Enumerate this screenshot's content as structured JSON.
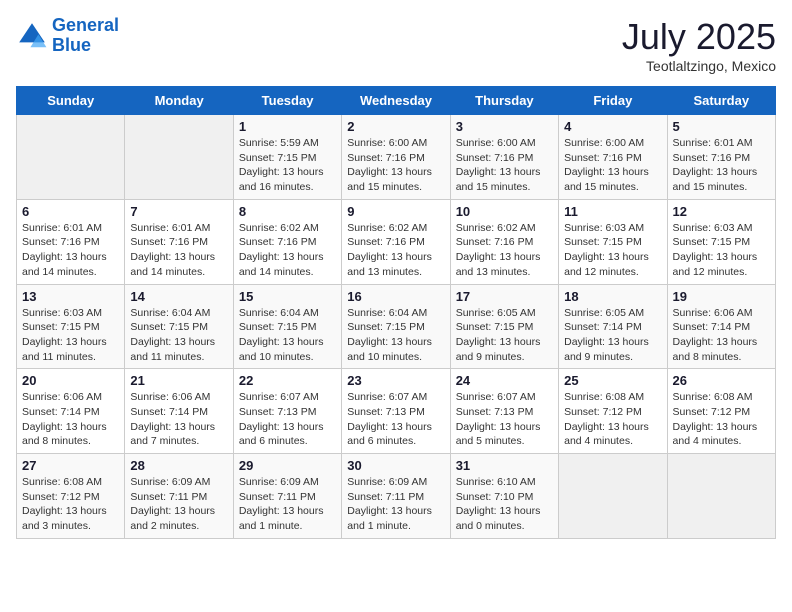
{
  "header": {
    "logo_line1": "General",
    "logo_line2": "Blue",
    "month": "July 2025",
    "location": "Teotlaltzingo, Mexico"
  },
  "weekdays": [
    "Sunday",
    "Monday",
    "Tuesday",
    "Wednesday",
    "Thursday",
    "Friday",
    "Saturday"
  ],
  "weeks": [
    [
      {
        "day": "",
        "info": ""
      },
      {
        "day": "",
        "info": ""
      },
      {
        "day": "1",
        "info": "Sunrise: 5:59 AM\nSunset: 7:15 PM\nDaylight: 13 hours\nand 16 minutes."
      },
      {
        "day": "2",
        "info": "Sunrise: 6:00 AM\nSunset: 7:16 PM\nDaylight: 13 hours\nand 15 minutes."
      },
      {
        "day": "3",
        "info": "Sunrise: 6:00 AM\nSunset: 7:16 PM\nDaylight: 13 hours\nand 15 minutes."
      },
      {
        "day": "4",
        "info": "Sunrise: 6:00 AM\nSunset: 7:16 PM\nDaylight: 13 hours\nand 15 minutes."
      },
      {
        "day": "5",
        "info": "Sunrise: 6:01 AM\nSunset: 7:16 PM\nDaylight: 13 hours\nand 15 minutes."
      }
    ],
    [
      {
        "day": "6",
        "info": "Sunrise: 6:01 AM\nSunset: 7:16 PM\nDaylight: 13 hours\nand 14 minutes."
      },
      {
        "day": "7",
        "info": "Sunrise: 6:01 AM\nSunset: 7:16 PM\nDaylight: 13 hours\nand 14 minutes."
      },
      {
        "day": "8",
        "info": "Sunrise: 6:02 AM\nSunset: 7:16 PM\nDaylight: 13 hours\nand 14 minutes."
      },
      {
        "day": "9",
        "info": "Sunrise: 6:02 AM\nSunset: 7:16 PM\nDaylight: 13 hours\nand 13 minutes."
      },
      {
        "day": "10",
        "info": "Sunrise: 6:02 AM\nSunset: 7:16 PM\nDaylight: 13 hours\nand 13 minutes."
      },
      {
        "day": "11",
        "info": "Sunrise: 6:03 AM\nSunset: 7:15 PM\nDaylight: 13 hours\nand 12 minutes."
      },
      {
        "day": "12",
        "info": "Sunrise: 6:03 AM\nSunset: 7:15 PM\nDaylight: 13 hours\nand 12 minutes."
      }
    ],
    [
      {
        "day": "13",
        "info": "Sunrise: 6:03 AM\nSunset: 7:15 PM\nDaylight: 13 hours\nand 11 minutes."
      },
      {
        "day": "14",
        "info": "Sunrise: 6:04 AM\nSunset: 7:15 PM\nDaylight: 13 hours\nand 11 minutes."
      },
      {
        "day": "15",
        "info": "Sunrise: 6:04 AM\nSunset: 7:15 PM\nDaylight: 13 hours\nand 10 minutes."
      },
      {
        "day": "16",
        "info": "Sunrise: 6:04 AM\nSunset: 7:15 PM\nDaylight: 13 hours\nand 10 minutes."
      },
      {
        "day": "17",
        "info": "Sunrise: 6:05 AM\nSunset: 7:15 PM\nDaylight: 13 hours\nand 9 minutes."
      },
      {
        "day": "18",
        "info": "Sunrise: 6:05 AM\nSunset: 7:14 PM\nDaylight: 13 hours\nand 9 minutes."
      },
      {
        "day": "19",
        "info": "Sunrise: 6:06 AM\nSunset: 7:14 PM\nDaylight: 13 hours\nand 8 minutes."
      }
    ],
    [
      {
        "day": "20",
        "info": "Sunrise: 6:06 AM\nSunset: 7:14 PM\nDaylight: 13 hours\nand 8 minutes."
      },
      {
        "day": "21",
        "info": "Sunrise: 6:06 AM\nSunset: 7:14 PM\nDaylight: 13 hours\nand 7 minutes."
      },
      {
        "day": "22",
        "info": "Sunrise: 6:07 AM\nSunset: 7:13 PM\nDaylight: 13 hours\nand 6 minutes."
      },
      {
        "day": "23",
        "info": "Sunrise: 6:07 AM\nSunset: 7:13 PM\nDaylight: 13 hours\nand 6 minutes."
      },
      {
        "day": "24",
        "info": "Sunrise: 6:07 AM\nSunset: 7:13 PM\nDaylight: 13 hours\nand 5 minutes."
      },
      {
        "day": "25",
        "info": "Sunrise: 6:08 AM\nSunset: 7:12 PM\nDaylight: 13 hours\nand 4 minutes."
      },
      {
        "day": "26",
        "info": "Sunrise: 6:08 AM\nSunset: 7:12 PM\nDaylight: 13 hours\nand 4 minutes."
      }
    ],
    [
      {
        "day": "27",
        "info": "Sunrise: 6:08 AM\nSunset: 7:12 PM\nDaylight: 13 hours\nand 3 minutes."
      },
      {
        "day": "28",
        "info": "Sunrise: 6:09 AM\nSunset: 7:11 PM\nDaylight: 13 hours\nand 2 minutes."
      },
      {
        "day": "29",
        "info": "Sunrise: 6:09 AM\nSunset: 7:11 PM\nDaylight: 13 hours\nand 1 minute."
      },
      {
        "day": "30",
        "info": "Sunrise: 6:09 AM\nSunset: 7:11 PM\nDaylight: 13 hours\nand 1 minute."
      },
      {
        "day": "31",
        "info": "Sunrise: 6:10 AM\nSunset: 7:10 PM\nDaylight: 13 hours\nand 0 minutes."
      },
      {
        "day": "",
        "info": ""
      },
      {
        "day": "",
        "info": ""
      }
    ]
  ]
}
